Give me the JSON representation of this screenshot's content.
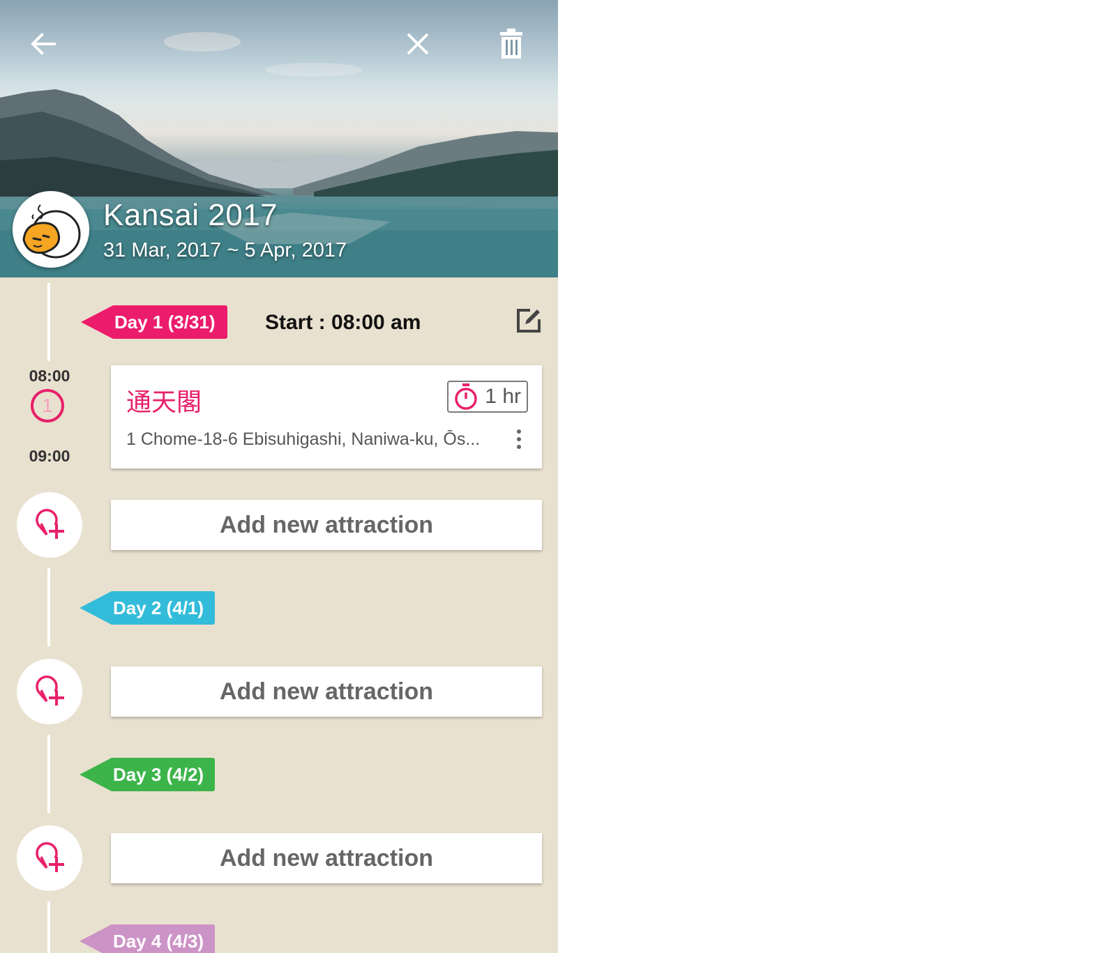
{
  "header": {
    "trip_title": "Kansai 2017",
    "trip_dates": "31 Mar, 2017 ~ 5 Apr, 2017",
    "icons": [
      "back-arrow-icon",
      "close-icon",
      "trash-icon"
    ]
  },
  "days": [
    {
      "label": "Day 1 (3/31)",
      "color": "#ec1c6c",
      "start_text": "Start : 08:00 am"
    },
    {
      "label": "Day 2 (4/1)",
      "color": "#33bcd9"
    },
    {
      "label": "Day 3 (4/2)",
      "color": "#3cb44a"
    },
    {
      "label": "Day 4 (4/3)",
      "color": "#cc93c6"
    }
  ],
  "attraction": {
    "number": "1",
    "start_time": "08:00",
    "end_time": "09:00",
    "name": "通天閣",
    "duration": "1 hr",
    "address": "1 Chome-18-6 Ebisuhigashi, Naniwa-ku, Ōs..."
  },
  "add_attraction_label": "Add new attraction",
  "colors": {
    "accent": "#e8206a",
    "background": "#e9e1cf"
  }
}
